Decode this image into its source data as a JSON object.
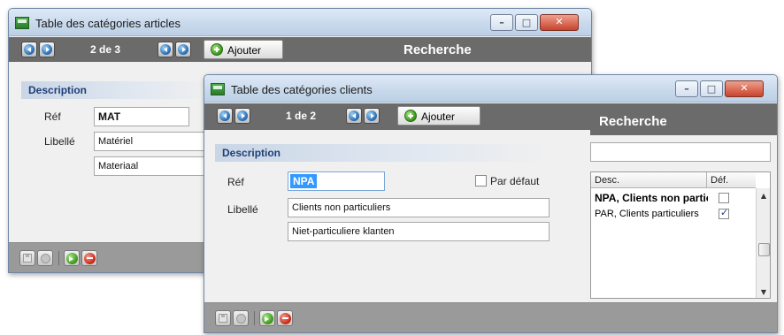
{
  "articles_window": {
    "title": "Table des catégories articles",
    "counter": "2 de 3",
    "add_label": "Ajouter",
    "search_label": "Recherche",
    "section_title": "Description",
    "ref_label": "Réf",
    "ref_value": "MAT",
    "libelle_label": "Libellé",
    "libelle_fr": "Matériel",
    "libelle_nl": "Materiaal"
  },
  "clients_window": {
    "title": "Table des catégories clients",
    "counter": "1 de 2",
    "add_label": "Ajouter",
    "search_label": "Recherche",
    "search_value": "",
    "section_title": "Description",
    "ref_label": "Réf",
    "ref_value": "NPA",
    "default_label": "Par défaut",
    "default_checked": false,
    "libelle_label": "Libellé",
    "libelle_fr": "Clients non particuliers",
    "libelle_nl": "Niet-particuliere klanten",
    "grid": {
      "columns": [
        "Desc.",
        "Déf."
      ],
      "rows": [
        {
          "desc": "NPA, Clients non particuliers",
          "default": false
        },
        {
          "desc": "PAR, Clients particuliers",
          "default": true
        }
      ]
    }
  },
  "window_buttons": {
    "minimize": "–",
    "maximize": "□",
    "close": "✕"
  },
  "colors": {
    "toolbar": "#6b6b6b",
    "bottombar": "#9a9a9a",
    "section_text": "#1f3f78",
    "selection": "#3399ff",
    "close_button": "#c9432c"
  }
}
